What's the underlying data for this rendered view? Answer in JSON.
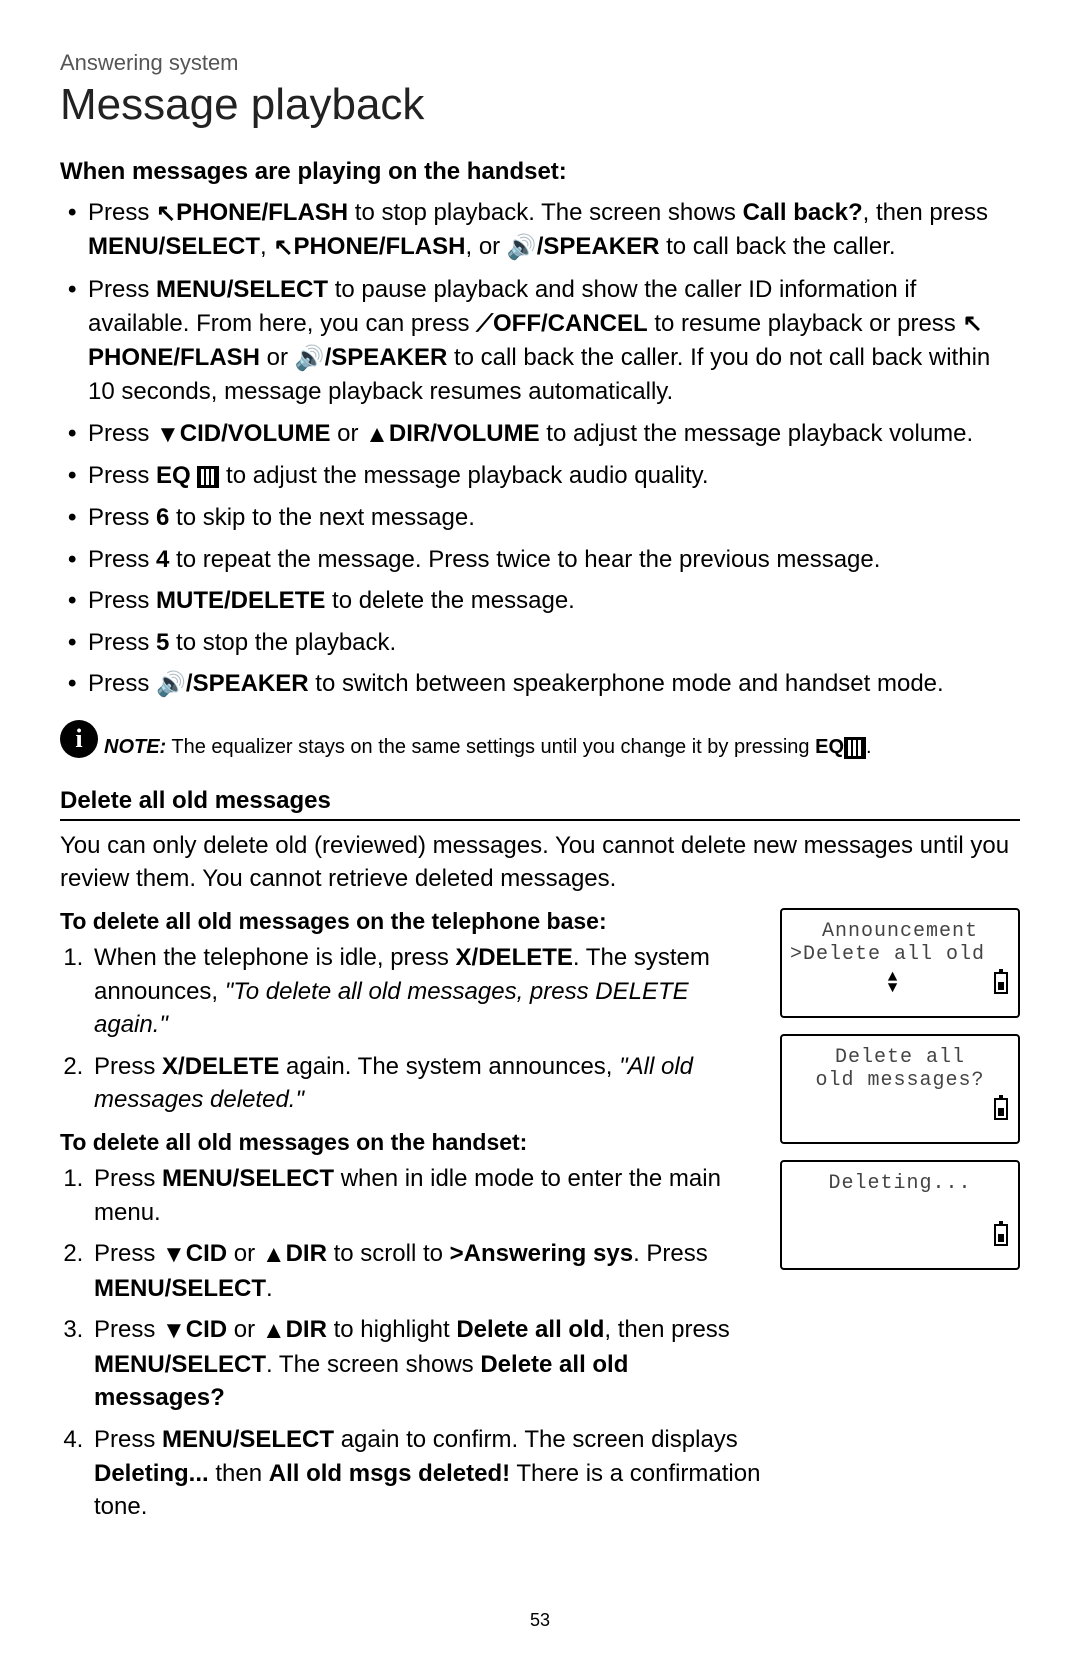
{
  "header": {
    "section": "Answering system",
    "title": "Message playback"
  },
  "playing": {
    "heading": "When messages are playing on the handset:",
    "b1": {
      "p1": "Press ",
      "phone": "PHONE/",
      "flash": "FLASH",
      "p2": " to stop playback. The screen shows ",
      "callback": "Call back?",
      "p3": ", then press ",
      "menusel": "MENU",
      "select": "/SELECT",
      "p4": ", ",
      "p5": ", or ",
      "speaker": "/SPEAKER",
      "p6": " to call back the caller."
    },
    "b2": {
      "p1": "Press ",
      "menusel": "MENU",
      "select": "/SELECT",
      "p2": " to pause playback and show the caller ID information if available. From here, you can press ",
      "off": "OFF",
      "cancel": "/CANCEL",
      "p3": " to resume playback or press ",
      "phone": "PHONE/",
      "flash": "FLASH",
      "p4": " or ",
      "speaker": "/SPEAKER",
      "p5": " to call back the caller. If you do not call back within 10 seconds, message playback resumes automatically."
    },
    "b3": {
      "p1": "Press ",
      "cid": "CID",
      "vol": "/VOLUME",
      "p2": " or ",
      "dir": "DIR",
      "p3": " to adjust the message playback volume."
    },
    "b4": {
      "p1": "Press ",
      "eq": "EQ",
      "p2": " to adjust the message playback audio quality."
    },
    "b5": {
      "p1": "Press ",
      "k": "6",
      "p2": " to skip to the next message."
    },
    "b6": {
      "p1": "Press ",
      "k": "4",
      "p2": " to repeat the message. Press twice to hear the previous message."
    },
    "b7": {
      "p1": "Press ",
      "mute": "MUTE",
      "del": "/DELETE",
      "p2": " to delete the message."
    },
    "b8": {
      "p1": "Press ",
      "k": "5",
      "p2": " to stop the playback."
    },
    "b9": {
      "p1": "Press ",
      "speaker": "/SPEAKER",
      "p2": " to switch between speakerphone mode and handset mode."
    }
  },
  "note": {
    "label": "NOTE:",
    "text": " The equalizer stays on the same settings until you change it by pressing ",
    "eq": "EQ",
    "period": "."
  },
  "delete": {
    "heading": "Delete all old messages",
    "intro": "You can only delete old (reviewed) messages. You cannot delete new messages until you review them. You cannot retrieve deleted messages.",
    "base_heading": "To delete all old messages on the telephone base:",
    "base1": {
      "p1": "When the telephone is idle, press ",
      "xdel": "X/DELETE",
      "p2": ". The system announces, ",
      "q": "\"To delete all old messages, press DELETE again.\""
    },
    "base2": {
      "p1": "Press ",
      "xdel": "X/DELETE",
      "p2": " again. The system announces, ",
      "q": "\"All old messages deleted.\""
    },
    "handset_heading": "To delete all old messages on the handset:",
    "h1": {
      "p1": "Press ",
      "menu": "MENU/",
      "select": "SELECT",
      "p2": " when in idle mode to enter the main menu."
    },
    "h2": {
      "p1": "Press ",
      "cid": "CID",
      "p2": " or ",
      "dir": "DIR",
      "p3": " to scroll to ",
      "ans": ">Answering sys",
      "p4": ". Press ",
      "menusel": "MENU",
      "select": "/SELECT",
      "p5": "."
    },
    "h3": {
      "p1": "Press ",
      "cid": "CID",
      "p2": " or ",
      "dir": "DIR",
      "p3": " to highlight ",
      "del": "Delete all old",
      "p4": ", then press ",
      "menusel": "MENU",
      "select": "/SELECT",
      "p5": ". The screen shows ",
      "q": "Delete all old messages?"
    },
    "h4": {
      "p1": "Press ",
      "menusel": "MENU",
      "select": "/SELECT",
      "p2": " again to confirm. The screen displays ",
      "deleting": "Deleting...",
      "p3": " then ",
      "done": "All old msgs deleted!",
      "p4": " There is a confirmation tone."
    }
  },
  "screens": {
    "s1l1": "Announcement",
    "s1l2": ">Delete all old",
    "s2l1": "Delete all",
    "s2l2": "old messages?",
    "s3l1": "Deleting..."
  },
  "page_number": "53",
  "glyphs": {
    "info": "i"
  }
}
